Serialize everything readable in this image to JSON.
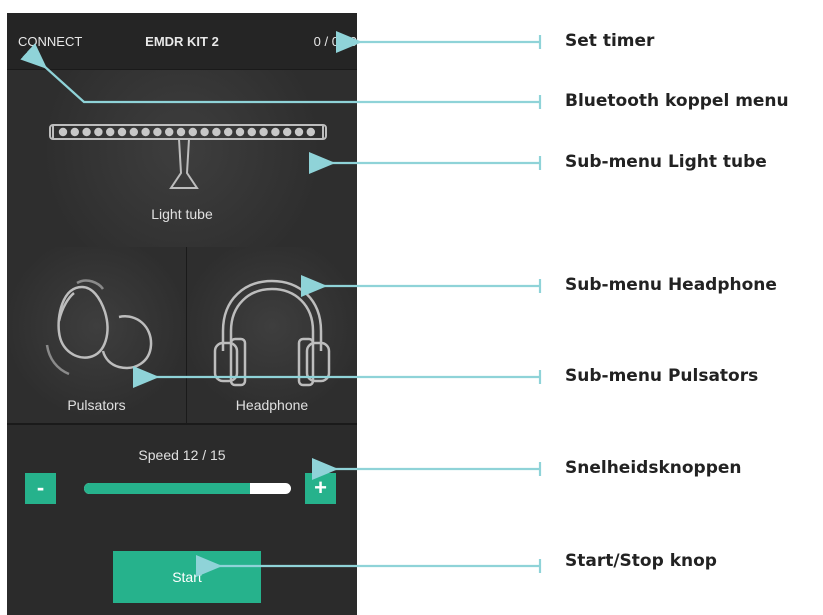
{
  "app": {
    "connect_label": "CONNECT",
    "title": "EMDR KIT 2",
    "timer": "0 / 0:00"
  },
  "tiles": {
    "light_tube": "Light tube",
    "pulsators": "Pulsators",
    "headphone": "Headphone"
  },
  "speed": {
    "label": "Speed 12 / 15",
    "current": 12,
    "max": 15,
    "minus_label": "-",
    "plus_label": "+"
  },
  "start_label": "Start",
  "callouts": {
    "set_timer": "Set timer",
    "bluetooth": "Bluetooth koppel menu",
    "light_tube": "Sub-menu Light tube",
    "headphone": "Sub-menu Headphone",
    "pulsators": "Sub-menu Pulsators",
    "speed": "Snelheidsknoppen",
    "start": "Start/Stop knop"
  },
  "colors": {
    "accent": "#26b28c",
    "annotation_line": "#8fd3d8",
    "app_background": "#2b2b2b"
  }
}
